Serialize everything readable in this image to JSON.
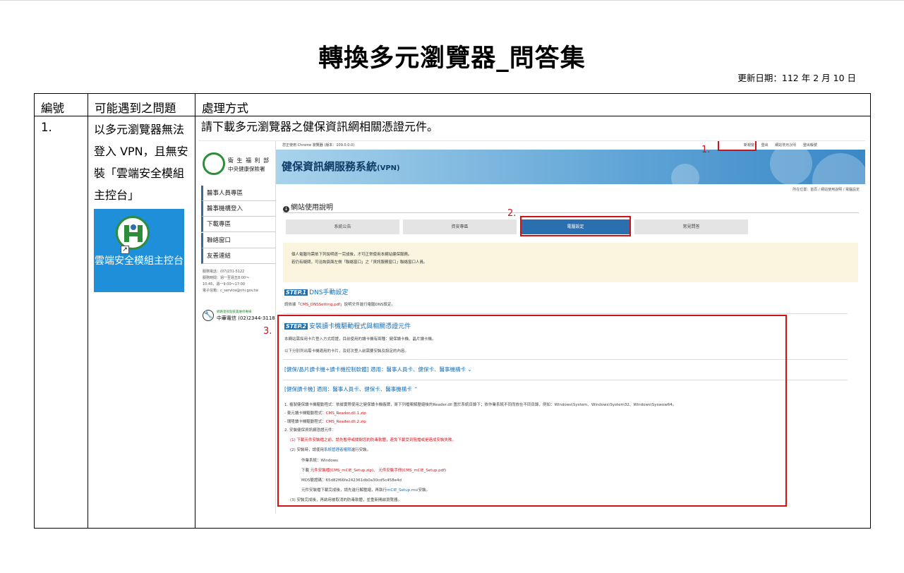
{
  "doc": {
    "title": "轉換多元瀏覽器_問答集",
    "update_date": "更新日期：112 年 2 月 10 日"
  },
  "table": {
    "headers": [
      "編號",
      "可能遇到之問題",
      "處理方式"
    ],
    "row": {
      "num": "1.",
      "issue": "以多元瀏覽器無法登入 VPN，且無安裝「雲端安全模組主控台」",
      "icon_label": "雲端安全模組主控台",
      "method": "請下載多元瀏覽器之健保資訊網相關憑證元件。"
    }
  },
  "screenshot": {
    "topbar_browser": "您正使用 Chrome 瀏覽器 (版本：109.0.0.0)",
    "topbar_links": [
      "新視窗",
      "登出",
      "網站使用說明",
      "登出帳號"
    ],
    "org_line1": "衛 生 福 利 部",
    "org_line2": "中央健康保險署",
    "banner_title": "健保資訊網服務系統",
    "banner_suffix": "(VPN)",
    "nav": [
      "醫事人員專區",
      "醫事機構登入",
      "下載專區",
      "聯絡窗口",
      "友善連結"
    ],
    "contact": [
      "服務電話：(07)231-5122",
      "服務時間：週一至週五8:00～",
      "10:45，週一9:00～17:00",
      "電子信箱：c_service@nhi.gov.tw"
    ],
    "helpline1": "網路連接點裝置維修專線",
    "helpline2": "中華電信 (02)2344-3118",
    "breadcrumb": "所在位置：首頁 / 網站使用說明 / 電腦設定",
    "section_title": "網站使用說明",
    "tabs": [
      "系統公告",
      "資安專區",
      "電腦設定",
      "常見問答"
    ],
    "notice1": "個人電腦均需依下列說明逐一完成後，才可正常使用本網站健保服務。",
    "notice2": "若仍有疑問，可洽詢頁面左側「聯絡窗口」之「資訊服務窗口」聯絡窗口人員。",
    "step1_badge": "STEP.1",
    "step1_title": "DNS手動設定",
    "step1_desc_prefix": "請依據「",
    "step1_link": "CMS_DNSSetting.pdf",
    "step1_desc_suffix": "」說明文件進行電腦DNS設定。",
    "step2_badge": "STEP.2",
    "step2_title": "安裝讀卡機驅動程式與相關憑證元件",
    "step2_desc1": "本網站需採用卡片登入方式認證，目前使用的讀卡機有兩種：健保讀卡機、晶片讀卡機。",
    "step2_desc2": "以下分別列出需卡機適用的卡片，及初次登入前需要安裝及設定的內容。",
    "acc1": "[健保/晶片讀卡機+讀卡機控制軟體] 適用：醫事人員卡、健保卡、醫事機構卡 ⌄",
    "acc2": "[健保讀卡機] 適用：醫事人員卡、健保卡、醫事機構卡 ⌃",
    "inst1": "1. 複製健保讀卡機驅動程式：依據實際使用之健保讀卡機廠牌，將下列檔案解壓縮後的Reader.dll 置於系統目錄下；依作業系統不同而放在不同目錄，例如：Windows\\System、Windows\\System32、Windows\\Syswow64。",
    "inst2_prefix": "- 東元讀卡機驅動程式：",
    "inst2_link": "CMS_Reader.dll.1.zip",
    "inst3_prefix": "- 環隆讀卡機驅動程式：",
    "inst3_link": "CMS_Reader.dll.2.zip",
    "inst4": "2. 安裝健保資訊網憑證元件：",
    "inst5": "(1)  下載元件安裝檔之前，請先暫停或關閉您的防毒軟體，避免下載受到阻擋或是造成安裝失敗。",
    "inst6_prefix": "(2)  安裝時，請使用",
    "inst6_link": "系統管理者權限",
    "inst6_suffix": "進行安裝。",
    "inst7": "作業系統：Windows",
    "inst8_prefix": "下載",
    "inst8_link1": "元件安裝檔(CMS_mCIE_Setup.zip)",
    "inst8_mid": "、",
    "inst8_link2": "元件安裝手冊(CMS_mCIE_Setup.pdf)",
    "inst9": "MD5驗證碼：65d82f66fe242361db0a30cd5c458e4d",
    "inst10_prefix": "元件安裝檔下載完成後，請先進行解壓縮，再執行",
    "inst10_link": "mCIE_Setup.msi",
    "inst10_suffix": "安裝。",
    "inst11": "(3)  安裝完成後，再啟用被取消的防毒軟體，並重新開啟瀏覽器。"
  },
  "annotations": {
    "a1": "1.",
    "a2": "2.",
    "a3": "3."
  },
  "colors": {
    "highlight": "#d0121b",
    "brand_blue": "#2a70b0",
    "notice_bg": "#fbf5df",
    "icon_bg": "#1e8fd8"
  }
}
